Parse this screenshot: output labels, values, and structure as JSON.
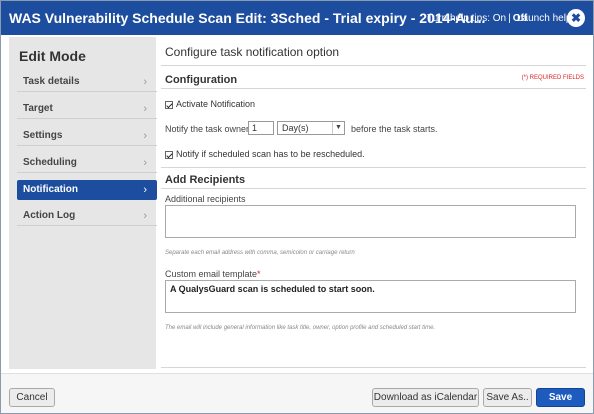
{
  "window": {
    "title": "WAS Vulnerability Schedule Scan Edit: 3Sched - Trial expiry - 2014-Au...",
    "help_prefix": "Turn help tips:",
    "help_on": "On",
    "help_sep": "|",
    "help_off": "Off",
    "launch_help": "Launch help",
    "close_glyph": "✖"
  },
  "sidebar": {
    "heading": "Edit Mode",
    "chevron": "›",
    "items": [
      {
        "label": "Task details"
      },
      {
        "label": "Target"
      },
      {
        "label": "Settings"
      },
      {
        "label": "Scheduling"
      },
      {
        "label": "Notification"
      },
      {
        "label": "Action Log"
      }
    ]
  },
  "main": {
    "page_title": "Configure task notification option",
    "configuration_heading": "Configuration",
    "required_note": "(*) REQUIRED FIELDS",
    "activate_label": "Activate Notification",
    "notify_owner_label": "Notify the task owner",
    "notify_value": "1",
    "unit_selected": "Day(s)",
    "before_label": "before the task starts.",
    "reschedule_label": "Notify if scheduled scan has to be rescheduled.",
    "add_recipients_heading": "Add Recipients",
    "additional_recipients_label": "Additional recipients",
    "additional_recipients_value": "",
    "recipients_hint": "Separate each email address with comma, semicolon or carriage return",
    "template_label": "Custom email template",
    "template_required": "*",
    "template_value": "A QualysGuard scan is scheduled to start soon.",
    "template_hint": "The email will include general information like task title, owner, option profile and scheduled start time."
  },
  "footer": {
    "cancel": "Cancel",
    "download": "Download as iCalendar",
    "save_as": "Save As..",
    "save": "Save"
  },
  "colors": {
    "accent": "#1d4d9e",
    "primary_button": "#1d5bbf",
    "sidebar_bg": "#e6e6e6",
    "required": "#dd2222"
  },
  "icons": {
    "close": "close-icon",
    "chevron": "chevron-right-icon",
    "checkbox": "checkmark-icon",
    "dropdown": "chevron-down-icon"
  }
}
